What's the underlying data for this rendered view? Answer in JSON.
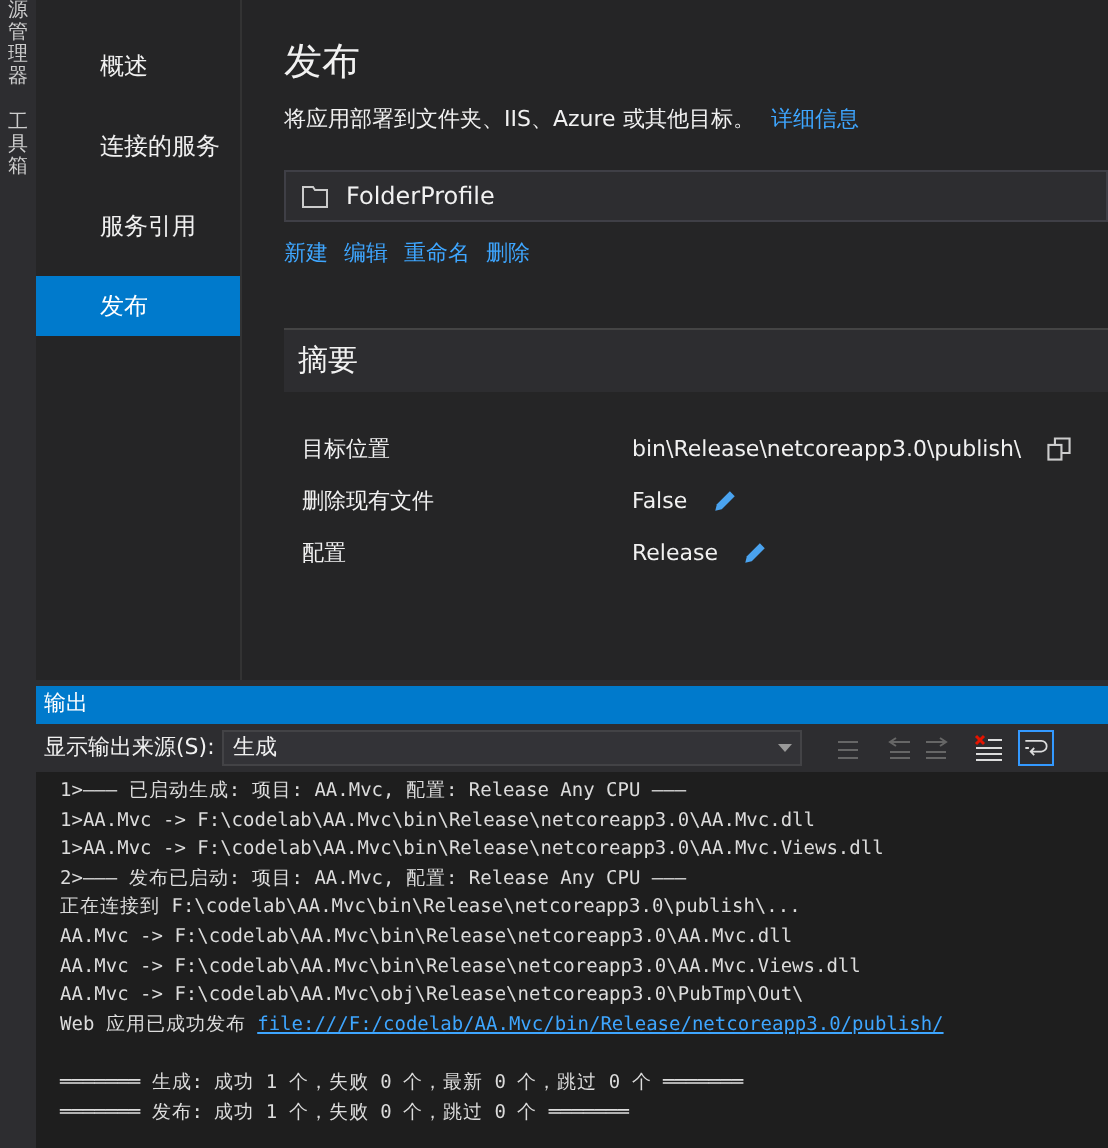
{
  "side_tabs": [
    "源管理器",
    "工具箱"
  ],
  "nav": [
    {
      "label": "概述",
      "selected": false
    },
    {
      "label": "连接的服务",
      "selected": false
    },
    {
      "label": "服务引用",
      "selected": false
    },
    {
      "label": "发布",
      "selected": true
    }
  ],
  "publish": {
    "title": "发布",
    "description": "将应用部署到文件夹、IIS、Azure 或其他目标。",
    "details_link": "详细信息",
    "profile": "FolderProfile",
    "actions": [
      "新建",
      "编辑",
      "重命名",
      "删除"
    ]
  },
  "summary": {
    "title": "摘要",
    "rows": [
      {
        "label": "目标位置",
        "value": "bin\\Release\\netcoreapp3.0\\publish\\",
        "kind": "copy"
      },
      {
        "label": "删除现有文件",
        "value": "False",
        "kind": "edit"
      },
      {
        "label": "配置",
        "value": "Release",
        "kind": "edit"
      }
    ]
  },
  "output": {
    "title": "输出",
    "source_label": "显示输出来源(S):",
    "source_value": "生成",
    "lines": [
      {
        "text": "1>——— 已启动生成: 项目: AA.Mvc, 配置: Release Any CPU ———"
      },
      {
        "text": "1>AA.Mvc -> F:\\codelab\\AA.Mvc\\bin\\Release\\netcoreapp3.0\\AA.Mvc.dll"
      },
      {
        "text": "1>AA.Mvc -> F:\\codelab\\AA.Mvc\\bin\\Release\\netcoreapp3.0\\AA.Mvc.Views.dll"
      },
      {
        "text": "2>——— 发布已启动: 项目: AA.Mvc, 配置: Release Any CPU ———"
      },
      {
        "text": "正在连接到 F:\\codelab\\AA.Mvc\\bin\\Release\\netcoreapp3.0\\publish\\..."
      },
      {
        "text": "AA.Mvc -> F:\\codelab\\AA.Mvc\\bin\\Release\\netcoreapp3.0\\AA.Mvc.dll"
      },
      {
        "text": "AA.Mvc -> F:\\codelab\\AA.Mvc\\bin\\Release\\netcoreapp3.0\\AA.Mvc.Views.dll"
      },
      {
        "text": "AA.Mvc -> F:\\codelab\\AA.Mvc\\obj\\Release\\netcoreapp3.0\\PubTmp\\Out\\"
      },
      {
        "text": "Web 应用已成功发布",
        "link": "file:///F:/codelab/AA.Mvc/bin/Release/netcoreapp3.0/publish/"
      },
      {
        "text": "═══════ 生成: 成功 1 个，失败 0 个，最新 0 个，跳过 0 个 ═══════"
      },
      {
        "text": "═══════ 发布: 成功 1 个，失败 0 个，跳过 0 个 ═══════"
      }
    ]
  }
}
